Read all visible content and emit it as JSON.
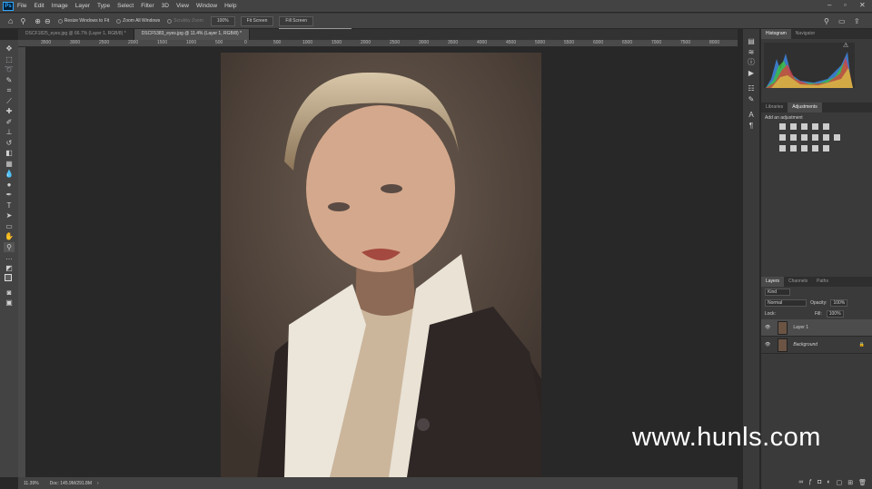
{
  "menubar": {
    "logo": "Ps",
    "items": [
      "File",
      "Edit",
      "Image",
      "Layer",
      "Type",
      "Select",
      "Filter",
      "3D",
      "View",
      "Window",
      "Help"
    ]
  },
  "options": {
    "resize": "Resize Windows to Fit",
    "zoom_all": "Zoom All Windows",
    "scrubby": "Scrubby Zoom",
    "zoom_value": "100%",
    "fit_screen": "Fit Screen",
    "fill_screen": "Fill Screen",
    "tooltip": "Zoom current window to screen size"
  },
  "tabs": [
    {
      "label": "DSCF1825_eyes.jpg @ 66.7% (Layer 1, RGB/8) *"
    },
    {
      "label": "DSCF5383_eyes.jpg @ 11.4% (Layer 1, RGB/8) *"
    }
  ],
  "ruler": [
    "3500",
    "3000",
    "2500",
    "2000",
    "1500",
    "1000",
    "500",
    "0",
    "500",
    "1000",
    "1500",
    "2000",
    "2500",
    "3000",
    "3500",
    "4000",
    "4500",
    "5000",
    "5500",
    "6000",
    "6500",
    "7000",
    "7500",
    "8000",
    "8500"
  ],
  "status": {
    "zoom": "11.39%",
    "doc": "Doc: 145.9M/291.8M"
  },
  "panels": {
    "histogram_tabs": [
      "Histogram",
      "Navigator"
    ],
    "adj_tabs": [
      "Libraries",
      "Adjustments"
    ],
    "adj_title": "Add an adjustment",
    "layer_tabs": [
      "Layers",
      "Channels",
      "Paths"
    ],
    "kind": "Kind",
    "blend": "Normal",
    "opacity_label": "Opacity:",
    "opacity": "100%",
    "lock_label": "Lock:",
    "fill_label": "Fill:",
    "fill": "100%",
    "layers": [
      {
        "name": "Layer 1",
        "selected": true
      },
      {
        "name": "Background",
        "selected": false
      }
    ]
  },
  "watermark": "www.hunls.com"
}
